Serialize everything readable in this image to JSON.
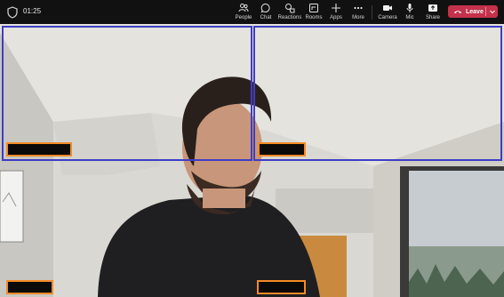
{
  "meeting": {
    "timer": "01:25",
    "toolbar": [
      {
        "label": "People",
        "icon": "people-icon"
      },
      {
        "label": "Chat",
        "icon": "chat-icon"
      },
      {
        "label": "Reactions",
        "icon": "reactions-icon"
      },
      {
        "label": "Rooms",
        "icon": "rooms-icon"
      },
      {
        "label": "Apps",
        "icon": "plus-icon"
      },
      {
        "label": "More",
        "icon": "more-icon"
      },
      {
        "label": "Camera",
        "icon": "camera-icon"
      },
      {
        "label": "Mic",
        "icon": "mic-icon"
      },
      {
        "label": "Share",
        "icon": "share-icon"
      }
    ],
    "leave_label": "Leave"
  },
  "colors": {
    "leave": "#c4314b",
    "tile_highlight": "#3f3ec4",
    "name_tag_border": "#f38a25"
  }
}
